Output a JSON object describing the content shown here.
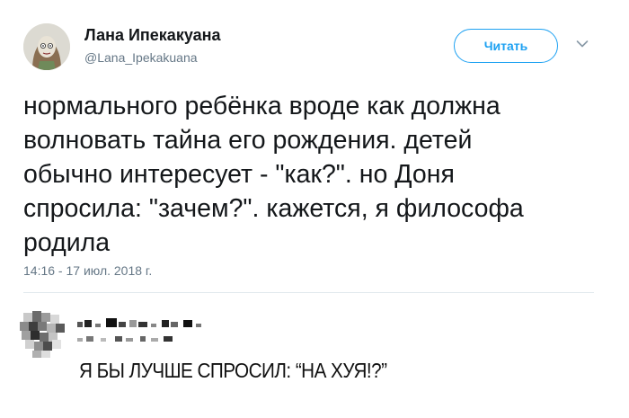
{
  "tweet": {
    "author_name": "Лана Ипекакуана",
    "author_handle": "@Lana_Ipekakuana",
    "follow_label": "Читать",
    "text_lines": [
      "нормального ребёнка вроде как должна",
      "волновать тайна его рождения. детей",
      "обычно интересует - \"как?\". но Доня",
      "спросила: \"зачем?\". кажется, я философа",
      "родила"
    ],
    "timestamp": "14:16 - 17 июл. 2018 г.",
    "icons": {
      "menu": "chevron-down-icon"
    }
  },
  "comment": {
    "text": "Я БЫ ЛУЧШЕ СПРОСИЛ: “НА ХУЯ!?”"
  },
  "colors": {
    "accent": "#1da1f2",
    "text": "#14171a",
    "secondary": "#657786",
    "divider": "#e1e8ed"
  }
}
